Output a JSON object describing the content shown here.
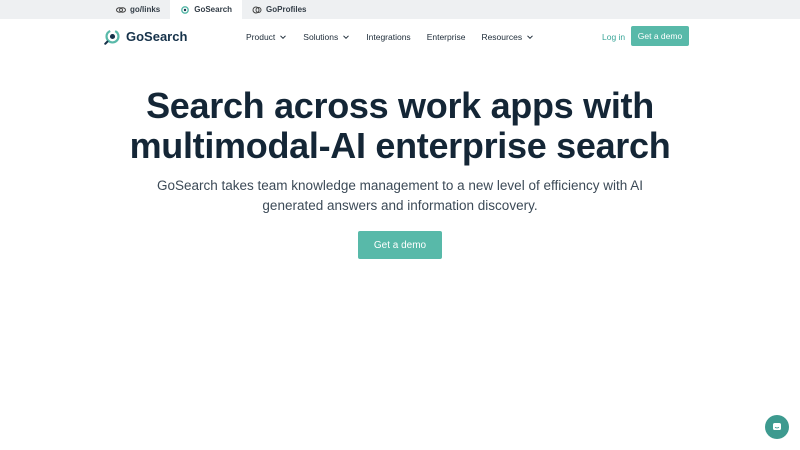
{
  "switcher": {
    "tabs": [
      {
        "label": "go/links",
        "icon": "golinks-icon",
        "active": false
      },
      {
        "label": "GoSearch",
        "icon": "gosearch-icon",
        "active": true
      },
      {
        "label": "GoProfiles",
        "icon": "goprofiles-icon",
        "active": false
      }
    ]
  },
  "nav": {
    "logo_text": "GoSearch",
    "menu": [
      {
        "label": "Product",
        "dropdown": true
      },
      {
        "label": "Solutions",
        "dropdown": true
      },
      {
        "label": "Integrations",
        "dropdown": false
      },
      {
        "label": "Enterprise",
        "dropdown": false
      },
      {
        "label": "Resources",
        "dropdown": true
      }
    ],
    "login_label": "Log in",
    "demo_label": "Get a demo"
  },
  "hero": {
    "title_line1": "Search across work apps with",
    "title_line2": "multimodal-AI enterprise search",
    "subtitle_line1": "GoSearch takes team knowledge management to a new level of efficiency with AI",
    "subtitle_line2": "generated answers and information discovery.",
    "cta_label": "Get a demo"
  },
  "chat": {
    "icon": "chat-icon"
  },
  "colors": {
    "accent": "#58b9a9",
    "heading": "#142636",
    "switcher_bg": "#eef0f2"
  }
}
